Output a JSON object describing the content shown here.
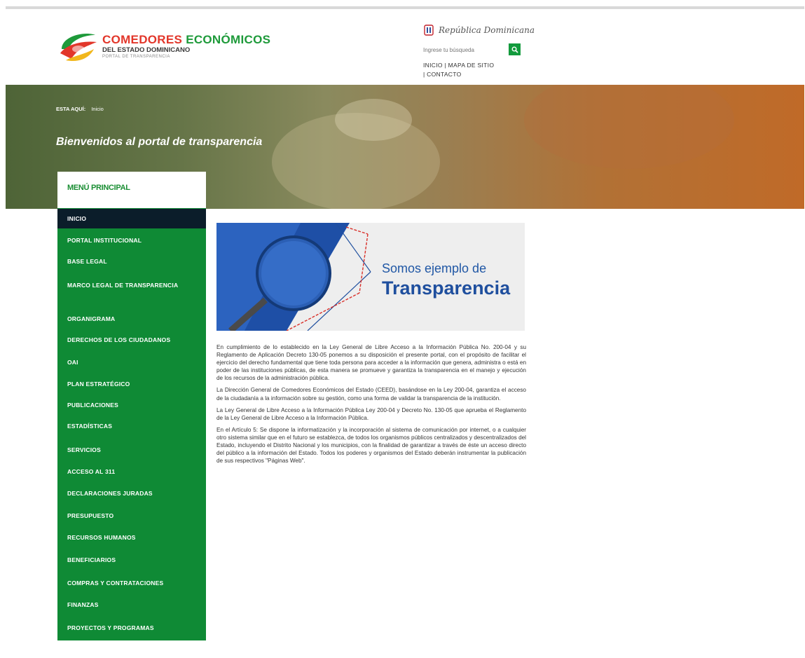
{
  "header": {
    "logo_title_1": "COMEDORES",
    "logo_title_2": "ECONÓMICOS",
    "logo_subtitle": "DEL ESTADO DOMINICANO",
    "logo_tagline": "PORTAL DE TRANSPARENCIA",
    "gov_label": "República Dominicana",
    "search_placeholder": "Ingrese tu búsqueda",
    "nav": [
      "INICIO",
      "MAPA DE SITIO",
      "CONTACTO"
    ]
  },
  "hero": {
    "breadcrumb_label": "ESTA AQUÍ:",
    "breadcrumb_current": "Inicio",
    "title": "Bienvenidos al portal de transparencia"
  },
  "sidebar": {
    "heading": "MENÚ PRINCIPAL",
    "items": [
      "INICIO",
      "PORTAL INSTITUCIONAL",
      "BASE LEGAL",
      "MARCO LEGAL DE TRANSPARENCIA",
      "ORGANIGRAMA",
      "DERECHOS DE LOS CIUDADANOS",
      "OAI",
      "PLAN ESTRATÉGICO",
      "PUBLICACIONES",
      "ESTADÍSTICAS",
      "SERVICIOS",
      "ACCESO AL 311",
      "DECLARACIONES JURADAS",
      "PRESUPUESTO",
      "RECURSOS HUMANOS",
      "BENEFICIARIOS",
      "COMPRAS Y CONTRATACIONES",
      "FINANZAS",
      "PROYECTOS Y PROGRAMAS"
    ]
  },
  "banner": {
    "line1": "Somos ejemplo de",
    "line2": "Transparencia"
  },
  "content": {
    "paragraphs": [
      "En cumplimiento de lo establecido en la Ley General de Libre Acceso a la Información Pública No. 200-04 y su Reglamento de Aplicación Decreto 130-05 ponemos a su disposición el presente portal, con el propósito de facilitar el ejercicio del derecho fundamental que tiene toda persona para acceder a la información que genera, administra o está en poder de las instituciones públicas, de esta manera se promueve y garantiza la transparencia en el manejo y ejecución de los recursos de la administración pública.",
      "La Dirección General de Comedores Económicos del Estado (CEED), basándose en la Ley 200-04, garantiza el acceso de la ciudadanía a la información sobre su gestión, como una forma de validar la transparencia de la institución.",
      "La Ley General de Libre Acceso a la Información Pública Ley 200-04 y Decreto No. 130-05 que aprueba el Reglamento de la Ley General de Libre Acceso a la Información Pública.",
      "En el Artículo 5: Se dispone la informatización y la incorporación al sistema de comunicación por internet, o a cualquier otro sistema similar que en el futuro se establezca, de todos los organismos públicos centralizados y descentralizados del Estado, incluyendo el Distrito Nacional y los municipios, con la finalidad de garantizar a través de éste un acceso directo del público a la información del Estado. Todos los poderes y organismos del Estado deberán instrumentar la publicación de sus respectivos \"Páginas Web\"."
    ]
  }
}
